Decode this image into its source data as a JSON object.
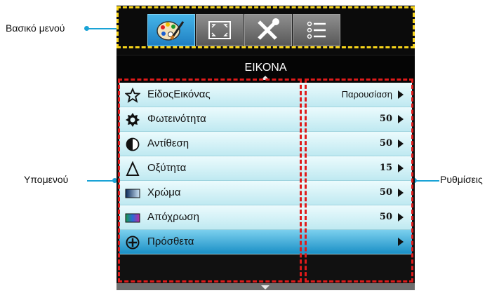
{
  "callouts": {
    "main_menu": "Βασικό μενού",
    "submenu": "Υπομενού",
    "settings": "Ρυθμίσεις"
  },
  "menu": {
    "title": "ΕΙΚΟΝΑ",
    "tabs": [
      {
        "icon": "palette-icon",
        "active": true
      },
      {
        "icon": "screen-frame-icon",
        "active": false
      },
      {
        "icon": "tools-icon",
        "active": false
      },
      {
        "icon": "list-icon",
        "active": false
      }
    ],
    "items": [
      {
        "label": "ΕίδοςΕικόνας",
        "value": "Παρουσίαση",
        "icon": "star-outline-icon"
      },
      {
        "label": "Φωτεινότητα",
        "value": "50",
        "icon": "sun-icon"
      },
      {
        "label": "Αντίθεση",
        "value": "50",
        "icon": "contrast-icon"
      },
      {
        "label": "Οξύτητα",
        "value": "15",
        "icon": "sharpness-delta-icon"
      },
      {
        "label": "Χρώμα",
        "value": "50",
        "icon": "color-gradient-icon"
      },
      {
        "label": "Απόχρωση",
        "value": "50",
        "icon": "tint-gradient-icon"
      },
      {
        "label": "Πρόσθετα",
        "value": "",
        "icon": "plus-circle-icon"
      }
    ]
  },
  "colors": {
    "leader": "#1aa3d6",
    "highlight_yellow": "#f6d31a",
    "highlight_red": "#e01a1a",
    "selected_row": "#1a8fc6"
  }
}
